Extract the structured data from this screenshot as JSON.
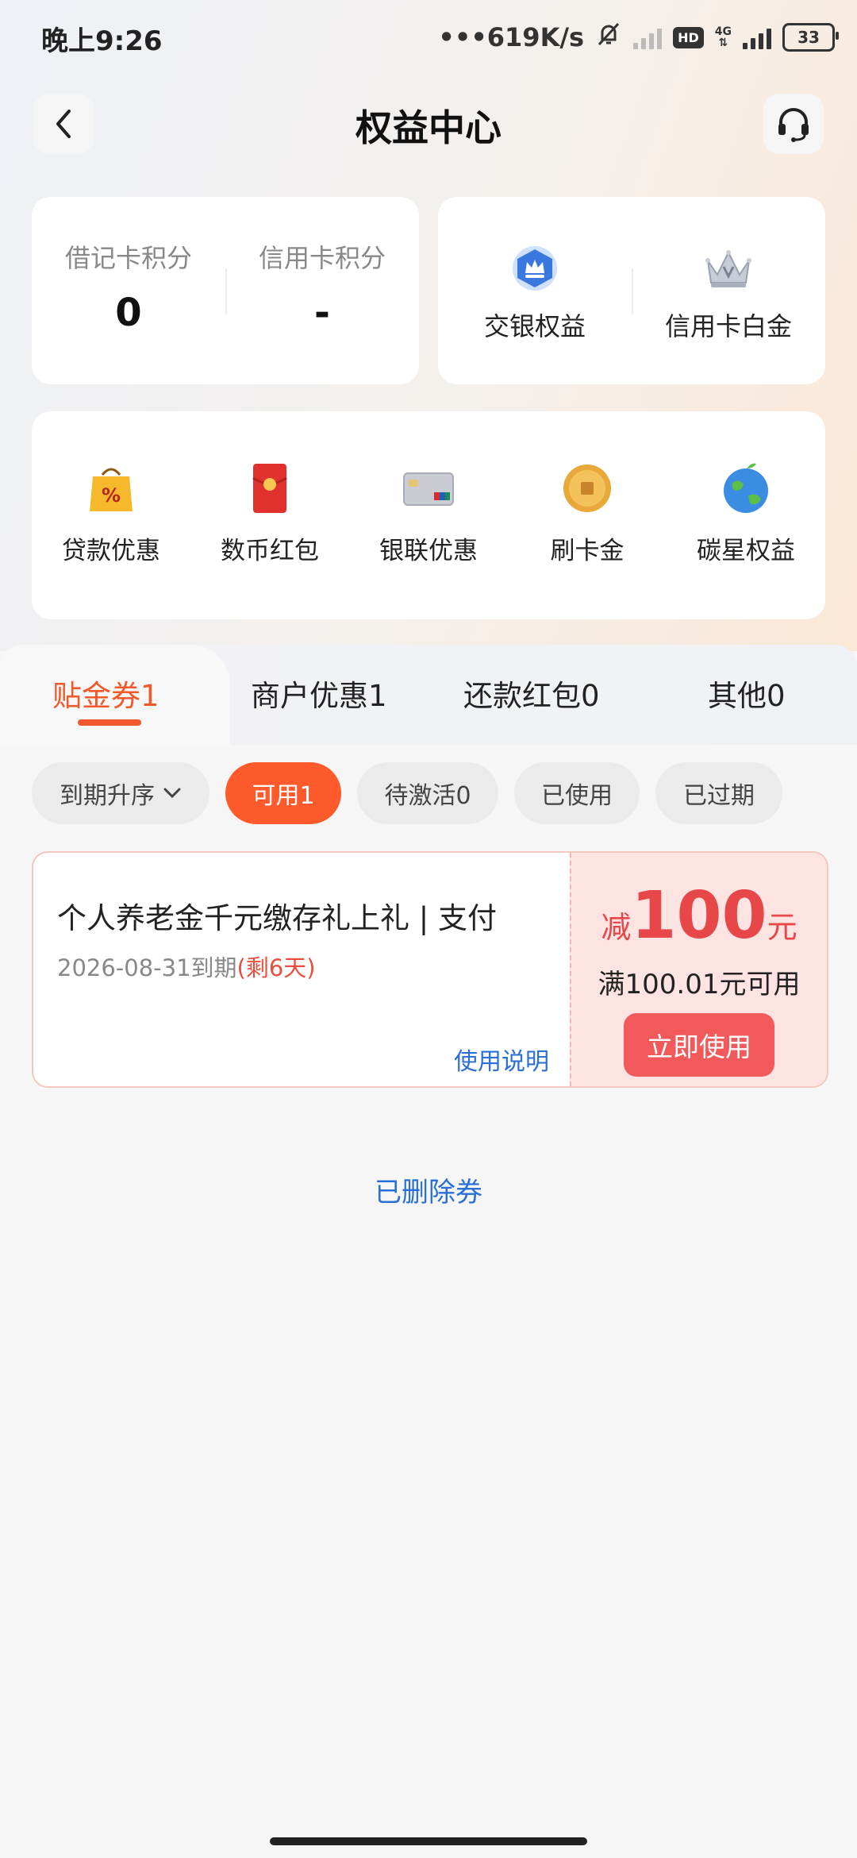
{
  "status_bar": {
    "time": "晚上9:26",
    "network_speed": "•••619K/s",
    "hd_label": "HD",
    "network_type": "4G",
    "battery": "33"
  },
  "header": {
    "title": "权益中心"
  },
  "points": {
    "debit_label": "借记卡积分",
    "debit_value": "0",
    "credit_label": "信用卡积分",
    "credit_value": "-"
  },
  "rights": {
    "bocom_label": "交银权益",
    "platinum_label": "信用卡白金"
  },
  "services": [
    {
      "label": "贷款优惠",
      "icon": "percent-bag-icon"
    },
    {
      "label": "数币红包",
      "icon": "red-envelope-icon"
    },
    {
      "label": "银联优惠",
      "icon": "unionpay-card-icon"
    },
    {
      "label": "刷卡金",
      "icon": "gold-coin-icon"
    },
    {
      "label": "碳星权益",
      "icon": "earth-icon"
    }
  ],
  "tabs": [
    {
      "label": "贴金券1",
      "active": true
    },
    {
      "label": "商户优惠1"
    },
    {
      "label": "还款红包0"
    },
    {
      "label": "其他0"
    }
  ],
  "filters": {
    "sort": "到期升序",
    "chips": [
      "可用1",
      "待激活0",
      "已使用",
      "已过期"
    ]
  },
  "coupon": {
    "title": "个人养老金千元缴存礼上礼 | 支付",
    "expiry": "2026-08-31到期",
    "remaining": "(剩6天)",
    "howto": "使用说明",
    "amount_prefix": "减",
    "amount": "100",
    "amount_unit": "元",
    "condition": "满100.01元可用",
    "use_button": "立即使用"
  },
  "deleted_link": "已删除券",
  "colors": {
    "accent": "#f0592b",
    "chip_active": "#ff5a2b",
    "coupon_red": "#e8474a",
    "link_blue": "#2a6fd6"
  }
}
